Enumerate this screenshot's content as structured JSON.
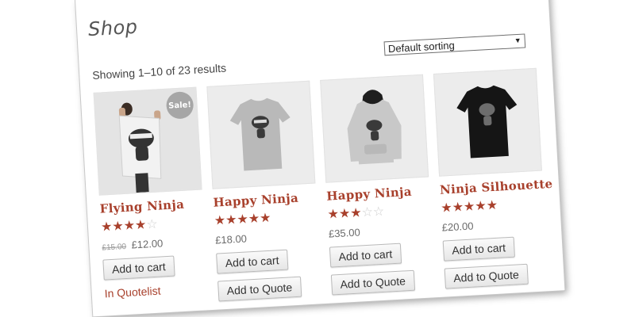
{
  "shop": {
    "title": "Shop",
    "result_count": "Showing 1–10 of 23 results",
    "sorting": {
      "selected": "Default sorting"
    }
  },
  "colors": {
    "accent": "#a8402c",
    "star_empty": "#cfcfcf",
    "badge": "#a6a6a6"
  },
  "products": [
    {
      "name": "Flying Ninja",
      "rating": 4,
      "rating_max": 5,
      "old_price": "£15.00",
      "price": "£12.00",
      "sale_badge": "Sale!",
      "add_to_cart": "Add to cart",
      "quote_status": "In Quotelist",
      "image": "poster-icon"
    },
    {
      "name": "Happy Ninja",
      "rating": 5,
      "rating_max": 5,
      "price": "£18.00",
      "add_to_cart": "Add to cart",
      "add_to_quote": "Add to Quote",
      "image": "tshirt-grey-icon"
    },
    {
      "name": "Happy Ninja",
      "rating": 3,
      "rating_max": 5,
      "price": "£35.00",
      "add_to_cart": "Add to cart",
      "add_to_quote": "Add to Quote",
      "image": "hoodie-icon"
    },
    {
      "name": "Ninja Silhouette",
      "rating": 5,
      "rating_max": 5,
      "price": "£20.00",
      "add_to_cart": "Add to cart",
      "add_to_quote": "Add to Quote",
      "image": "tshirt-black-icon"
    }
  ]
}
